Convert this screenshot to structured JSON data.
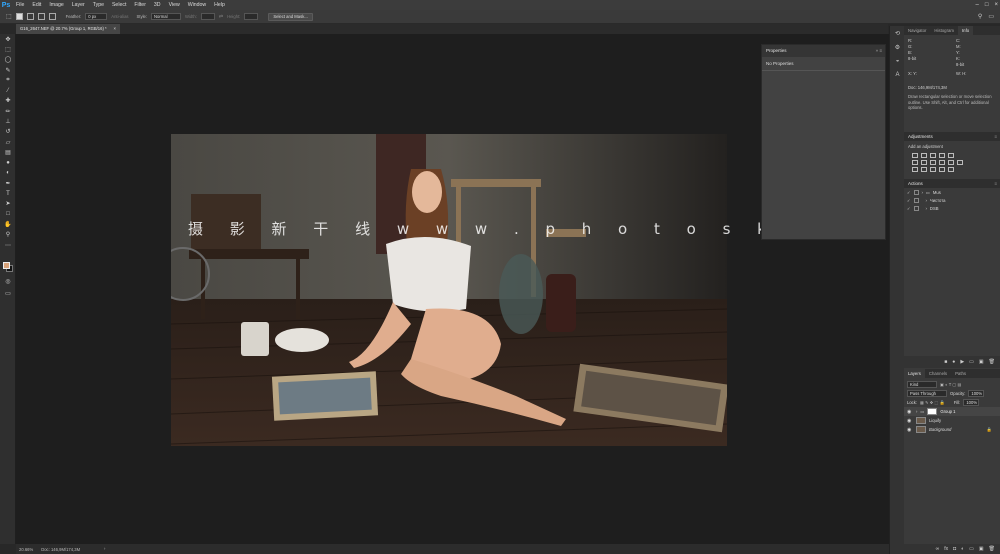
{
  "app": {
    "logo": "Ps",
    "menu": [
      "File",
      "Edit",
      "Image",
      "Layer",
      "Type",
      "Select",
      "Filter",
      "3D",
      "View",
      "Window",
      "Help"
    ]
  },
  "options": {
    "feather_label": "Feather:",
    "feather_value": "0 px",
    "antialias_label": "Anti-alias",
    "style_label": "Style:",
    "style_value": "Normal",
    "width_label": "Width:",
    "height_label": "Height:",
    "select_mask_label": "Select and Mask..."
  },
  "document": {
    "tab_title": "G16_2647.NEF @ 20.7% (Group 1, RGB/16) *",
    "close": "×"
  },
  "watermark": "摄 影 新 干 线   w w w . p h o t o s k s . v i p",
  "status": {
    "zoom": "20.66%",
    "doc": "Doc: 146,9M/174,3M",
    "arrow": "›"
  },
  "properties": {
    "tab": "Properties",
    "title": "No Properties"
  },
  "info_panel": {
    "tabs": [
      "Navigator",
      "Histogram",
      "Info"
    ],
    "r": "R:",
    "g": "G:",
    "b": "B:",
    "c": "C:",
    "m": "M:",
    "y": "Y:",
    "k": "K:",
    "bit1": "8-bit",
    "bit2": "8-bit",
    "x": "X:",
    "yy": "Y:",
    "w": "W:",
    "h": "H:",
    "doc": "Doc: 146,9M/174,3M",
    "help": "Draw rectangular selection or move selection outline. Use Shift, Alt, and Ctrl for additional options."
  },
  "adjustments": {
    "title": "Adjustments",
    "subtitle": "Add an adjustment"
  },
  "actions": {
    "title": "Actions",
    "items": [
      "Mus",
      "Чистота",
      "DSB"
    ]
  },
  "layers": {
    "tabs": [
      "Layers",
      "Channels",
      "Paths"
    ],
    "kind": "Kind",
    "blend": "Pass Through",
    "opacity_label": "Opacity:",
    "opacity_value": "100%",
    "lock_label": "Lock:",
    "fill_label": "Fill:",
    "fill_value": "100%",
    "items": [
      "Group 1",
      "Liquify",
      "Background"
    ]
  },
  "colors": {
    "fg_swatch": "#d9a37a",
    "bg_swatch": "#141414",
    "accent": "#31a8ff"
  }
}
